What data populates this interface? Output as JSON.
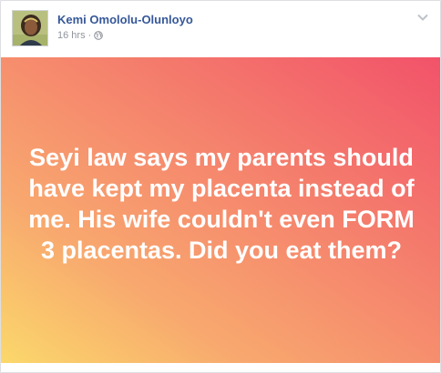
{
  "post": {
    "author": "Kemi Omololu-Olunloyo",
    "timestamp": "16 hrs",
    "separator": "·",
    "audience_icon": "globe-icon",
    "menu_icon": "chevron-down-icon",
    "link_color": "#365899",
    "meta_color": "#90949c"
  },
  "status": {
    "text": "Seyi law says my parents should have kept my placenta instead of me. His wife couldn't even FORM 3 placentas. Did you eat them?",
    "text_color": "#ffffff",
    "gradient": [
      "#fbd86b",
      "#f8a86e",
      "#f5856d",
      "#f2526a"
    ]
  }
}
